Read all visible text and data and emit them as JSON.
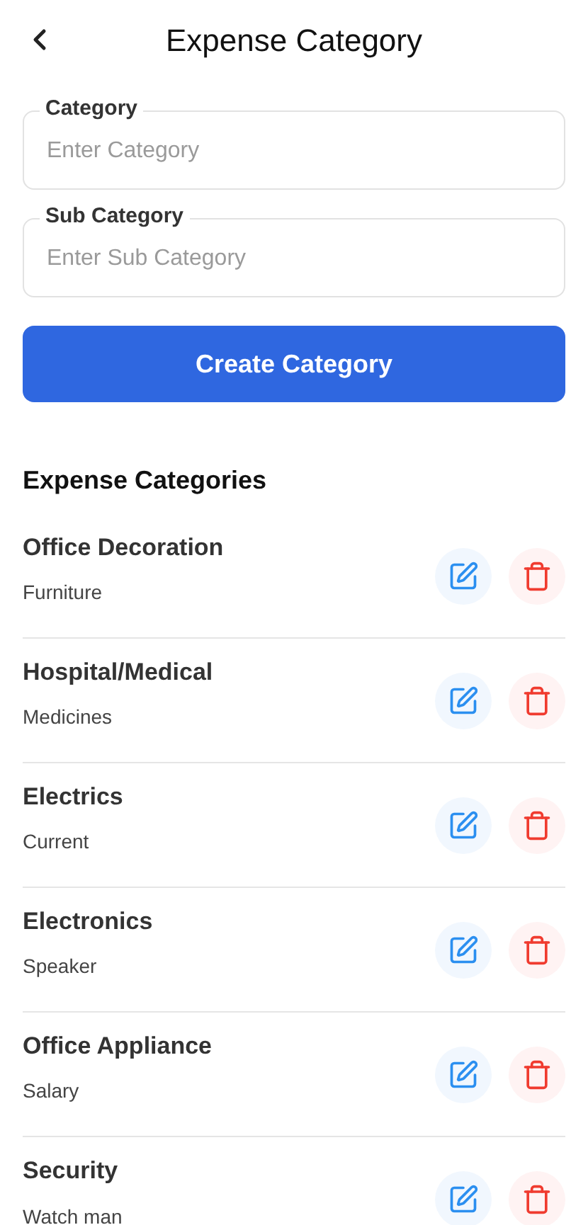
{
  "header": {
    "title": "Expense Category"
  },
  "form": {
    "fields": [
      {
        "label": "Category",
        "placeholder": "Enter Category"
      },
      {
        "label": "Sub Category",
        "placeholder": "Enter Sub Category"
      }
    ],
    "button": "Create Category"
  },
  "list": {
    "title": "Expense Categories",
    "items": [
      {
        "name": "Office Decoration",
        "sub": "Furniture"
      },
      {
        "name": "Hospital/Medical",
        "sub": "Medicines"
      },
      {
        "name": "Electrics",
        "sub": "Current"
      },
      {
        "name": "Electronics",
        "sub": "Speaker"
      },
      {
        "name": "Office Appliance",
        "sub": "Salary"
      },
      {
        "name": "Security",
        "sub": "Watch man"
      }
    ]
  }
}
